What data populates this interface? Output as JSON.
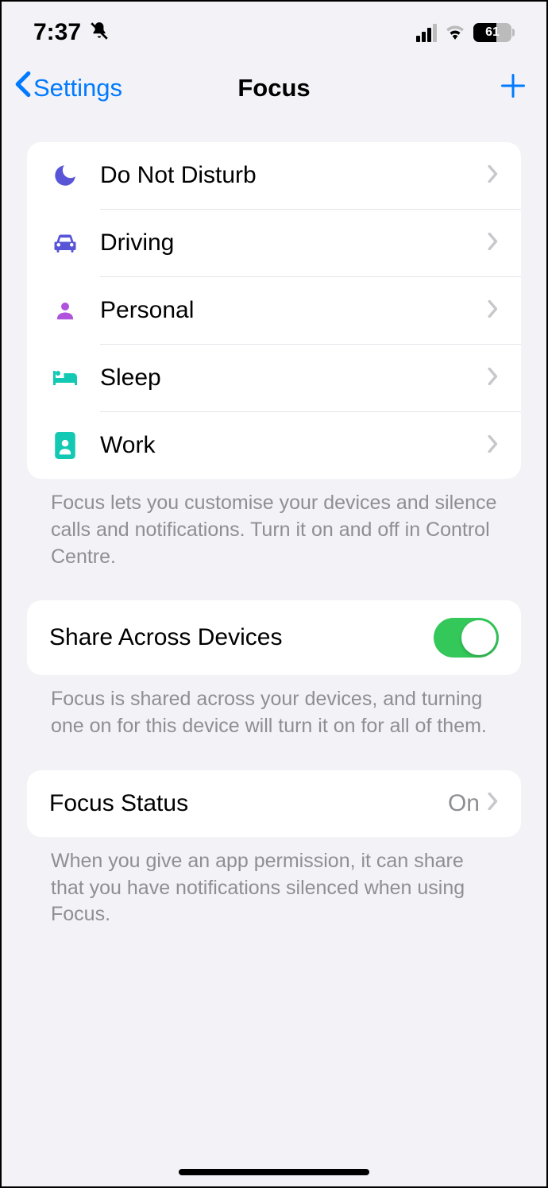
{
  "status": {
    "time": "7:37",
    "battery": "61"
  },
  "nav": {
    "back": "Settings",
    "title": "Focus"
  },
  "focus_list": [
    {
      "label": "Do Not Disturb",
      "icon": "moon",
      "color": "#5856d6"
    },
    {
      "label": "Driving",
      "icon": "car",
      "color": "#5856d6"
    },
    {
      "label": "Personal",
      "icon": "person",
      "color": "#af52de"
    },
    {
      "label": "Sleep",
      "icon": "bed",
      "color": "#14c9b3"
    },
    {
      "label": "Work",
      "icon": "badge",
      "color": "#14c9b3"
    }
  ],
  "focus_description": "Focus lets you customise your devices and silence calls and notifications. Turn it on and off in Control Centre.",
  "share": {
    "label": "Share Across Devices",
    "enabled": true,
    "description": "Focus is shared across your devices, and turning one on for this device will turn it on for all of them."
  },
  "status_row": {
    "label": "Focus Status",
    "value": "On",
    "description": "When you give an app permission, it can share that you have notifications silenced when using Focus."
  }
}
